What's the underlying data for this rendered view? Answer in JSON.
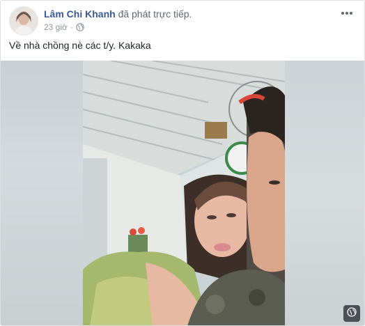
{
  "post": {
    "author": "Lâm Chi Khanh",
    "action": "đã phát trực tiếp.",
    "time": "23 giờ",
    "separator": "·",
    "privacy_icon": "globe-icon",
    "more_icon": "more-options-icon",
    "caption": "Về nhà chồng nè các t/y. Kakaka"
  },
  "video": {
    "settings_icon": "globe-icon"
  },
  "colors": {
    "link": "#385898",
    "meta": "#90949c",
    "text": "#1d2129"
  }
}
